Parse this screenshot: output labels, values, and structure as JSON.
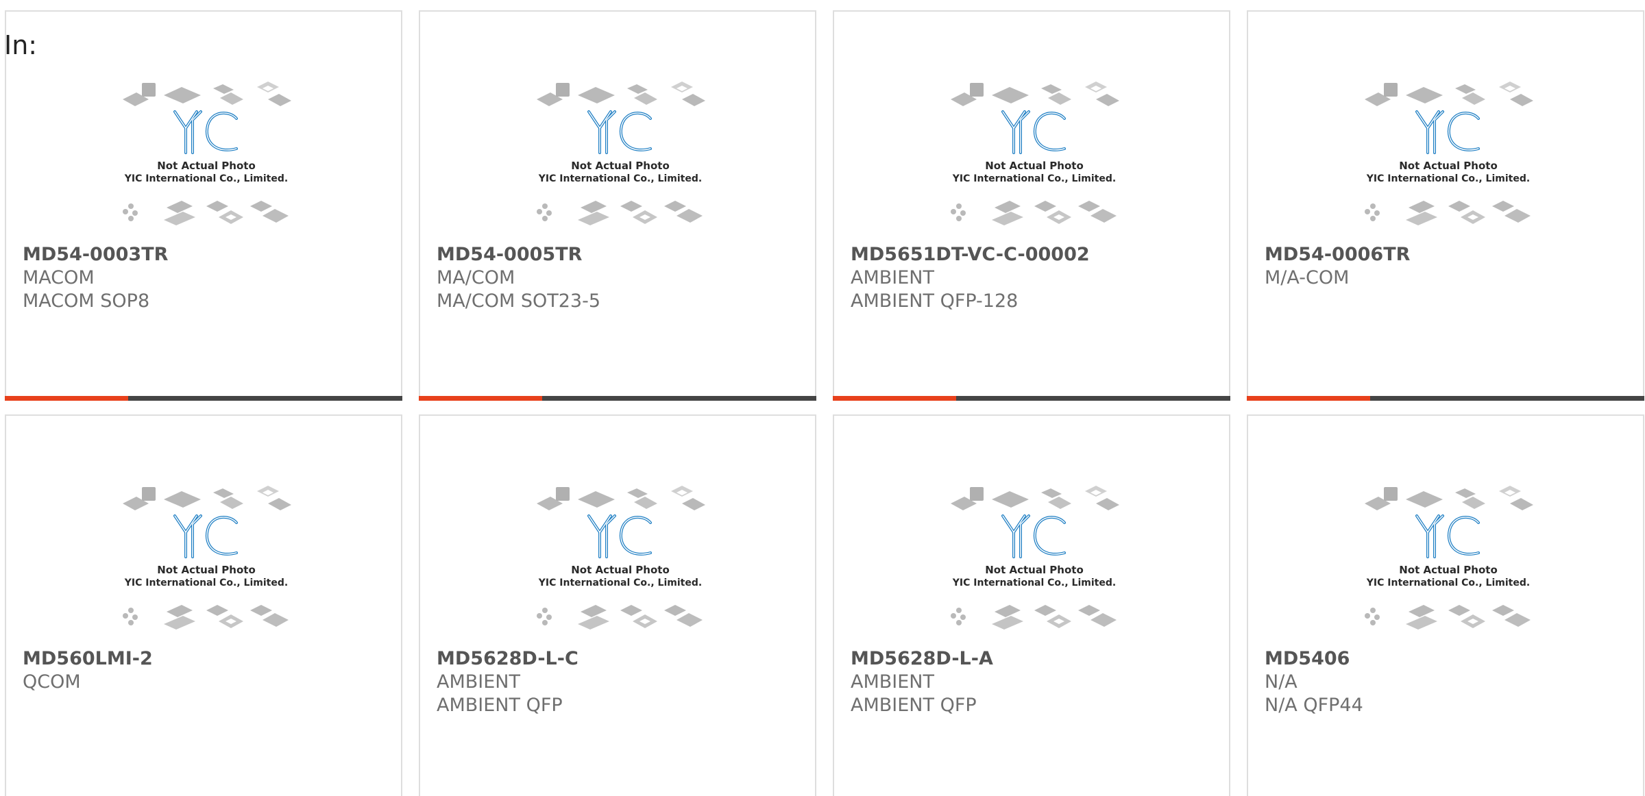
{
  "filter_label": "In:",
  "placeholder": {
    "caption_line1": "Not Actual Photo",
    "caption_line2": "YIC International Co., Limited."
  },
  "colors": {
    "accent": "#e8411c",
    "bar": "#454545",
    "border": "#dedede",
    "logo": "#1f7fc4"
  },
  "progress_fraction": 0.31,
  "products": [
    {
      "part_number": "MD54-0003TR",
      "manufacturer": "MACOM",
      "package": "MACOM SOP8",
      "show_bar": true
    },
    {
      "part_number": "MD54-0005TR",
      "manufacturer": "MA/COM",
      "package": "MA/COM SOT23-5",
      "show_bar": true
    },
    {
      "part_number": "MD5651DT-VC-C-00002",
      "manufacturer": "AMBIENT",
      "package": "AMBIENT QFP-128",
      "show_bar": true
    },
    {
      "part_number": "MD54-0006TR",
      "manufacturer": "M/A-COM",
      "package": "",
      "show_bar": true
    },
    {
      "part_number": "MD560LMI-2",
      "manufacturer": "QCOM",
      "package": "",
      "show_bar": false
    },
    {
      "part_number": "MD5628D-L-C",
      "manufacturer": "AMBIENT",
      "package": "AMBIENT QFP",
      "show_bar": false
    },
    {
      "part_number": "MD5628D-L-A",
      "manufacturer": "AMBIENT",
      "package": "AMBIENT QFP",
      "show_bar": false
    },
    {
      "part_number": "MD5406",
      "manufacturer": "N/A",
      "package": "N/A QFP44",
      "show_bar": false
    }
  ]
}
